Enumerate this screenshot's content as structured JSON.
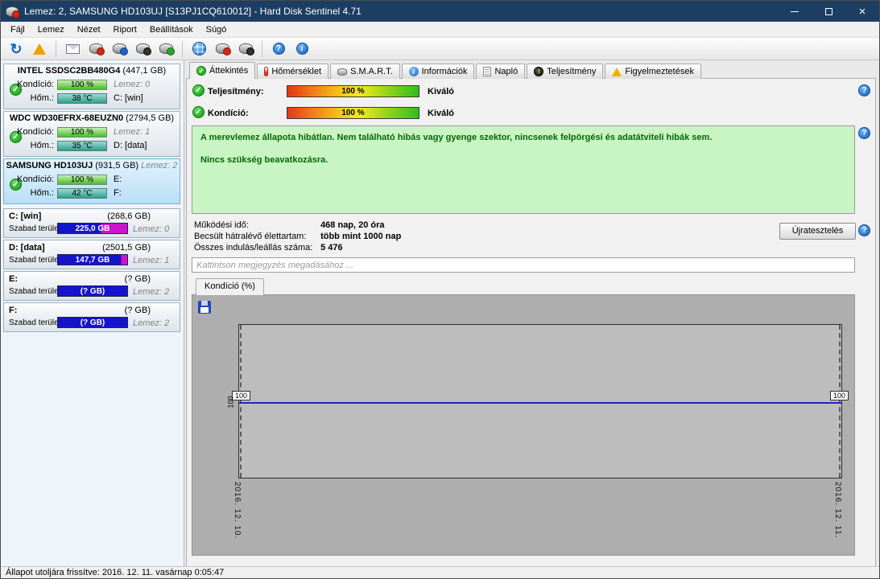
{
  "window": {
    "title": "Lemez: 2, SAMSUNG HD103UJ [S13PJ1CQ610012]  -  Hard Disk Sentinel 4.71"
  },
  "menu": {
    "items": [
      "Fájl",
      "Lemez",
      "Nézet",
      "Riport",
      "Beállítások",
      "Súgó"
    ]
  },
  "toolbar": {
    "buttons": [
      "refresh",
      "alerts",
      "send-report-email",
      "disk-tools",
      "disk-copy",
      "disk-remove",
      "disk-surface-test",
      "online",
      "disk-search",
      "disk-monitor",
      "help",
      "information"
    ]
  },
  "tabs": [
    {
      "label": "Áttekintés",
      "active": true
    },
    {
      "label": "Hőmérséklet",
      "active": false
    },
    {
      "label": "S.M.A.R.T.",
      "active": false
    },
    {
      "label": "Információk",
      "active": false
    },
    {
      "label": "Napló",
      "active": false
    },
    {
      "label": "Teljesítmény",
      "active": false
    },
    {
      "label": "Figyelmeztetések",
      "active": false
    }
  ],
  "sidebar": {
    "disks": [
      {
        "name": "INTEL SSDSC2BB480G4",
        "capacity": "(447,1 GB)",
        "header_right": "",
        "condition_label": "Kondíció:",
        "condition_value": "100 %",
        "temp_label": "Hőm.:",
        "temp_value": "38 °C",
        "right_top": "Lemez: 0",
        "right_bottom": "C: [win]"
      },
      {
        "name": "WDC WD30EFRX-68EUZN0",
        "capacity": "(2794,5 GB)",
        "header_right": "",
        "condition_label": "Kondíció:",
        "condition_value": "100 %",
        "temp_label": "Hőm.:",
        "temp_value": "35 °C",
        "right_top": "Lemez: 1",
        "right_bottom": "D: [data]"
      },
      {
        "name": "SAMSUNG HD103UJ",
        "capacity": "(931,5 GB)",
        "header_right": "Lemez: 2",
        "condition_label": "Kondíció:",
        "condition_value": "100 %",
        "temp_label": "Hőm.:",
        "temp_value": "42 °C",
        "right_top": "E:",
        "right_bottom": "F:"
      }
    ],
    "partitions": [
      {
        "name": "C: [win]",
        "capacity": "(268,6 GB)",
        "free_label": "Szabad terület",
        "free_value": "225,0 GB",
        "right": "Lemez: 0"
      },
      {
        "name": "D: [data]",
        "capacity": "(2501,5 GB)",
        "free_label": "Szabad terület",
        "free_value": "147,7 GB",
        "right": "Lemez: 1"
      },
      {
        "name": "E:",
        "capacity": "(? GB)",
        "free_label": "Szabad terület",
        "free_value": "(? GB)",
        "right": "Lemez: 2"
      },
      {
        "name": "F:",
        "capacity": "(? GB)",
        "free_label": "Szabad terület",
        "free_value": "(? GB)",
        "right": "Lemez: 2"
      }
    ]
  },
  "overview": {
    "performance_label": "Teljesítmény:",
    "performance_value": "100 %",
    "performance_rating": "Kiváló",
    "condition_label": "Kondíció:",
    "condition_value": "100 %",
    "condition_rating": "Kiváló",
    "status_line1": "A merevlemez állapota hibátlan. Nem található hibás vagy gyenge szektor, nincsenek felpörgési és adatátviteli hibák sem.",
    "status_line2": "Nincs szükség beavatkozásra.",
    "stats": [
      {
        "label": "Működési idő:",
        "value": "468 nap, 20 óra"
      },
      {
        "label": "Becsült hátralévő élettartam:",
        "value": "több mint 1000 nap"
      },
      {
        "label": "Összes indulás/leállás száma:",
        "value": "5 476"
      }
    ],
    "retest_button": "Újratesztelés",
    "comment_placeholder": "Kattintson megjegyzés megadásához ...",
    "graph_tab_label": "Kondíció  (%)"
  },
  "chart_data": {
    "type": "line",
    "title": "Kondíció (%)",
    "series": [
      {
        "name": "Kondíció",
        "values": [
          100,
          100
        ]
      }
    ],
    "x": [
      "2016. 12. 10.",
      "2016. 12. 11."
    ],
    "y_ticks": [
      "100"
    ],
    "point_labels": [
      "100",
      "100"
    ],
    "grid": false,
    "legend": "none",
    "line_color": "#2121cc"
  },
  "statusbar": {
    "text": "Állapot utoljára frissítve: 2016. 12. 11. vasárnap 0:05:47"
  },
  "colors": {
    "titlebar": "#1c3e63",
    "condition_bar_green": "#46bd2c",
    "temp_bar_teal": "#2f9e90",
    "free_bar_blue": "#1414cc",
    "free_bar_magenta": "#cc14cc",
    "status_box_bg": "#c9f4c3",
    "status_text_green": "#056805",
    "selected_disk_bg": "#cfe7fa",
    "chart_line_blue": "#2121cc"
  }
}
